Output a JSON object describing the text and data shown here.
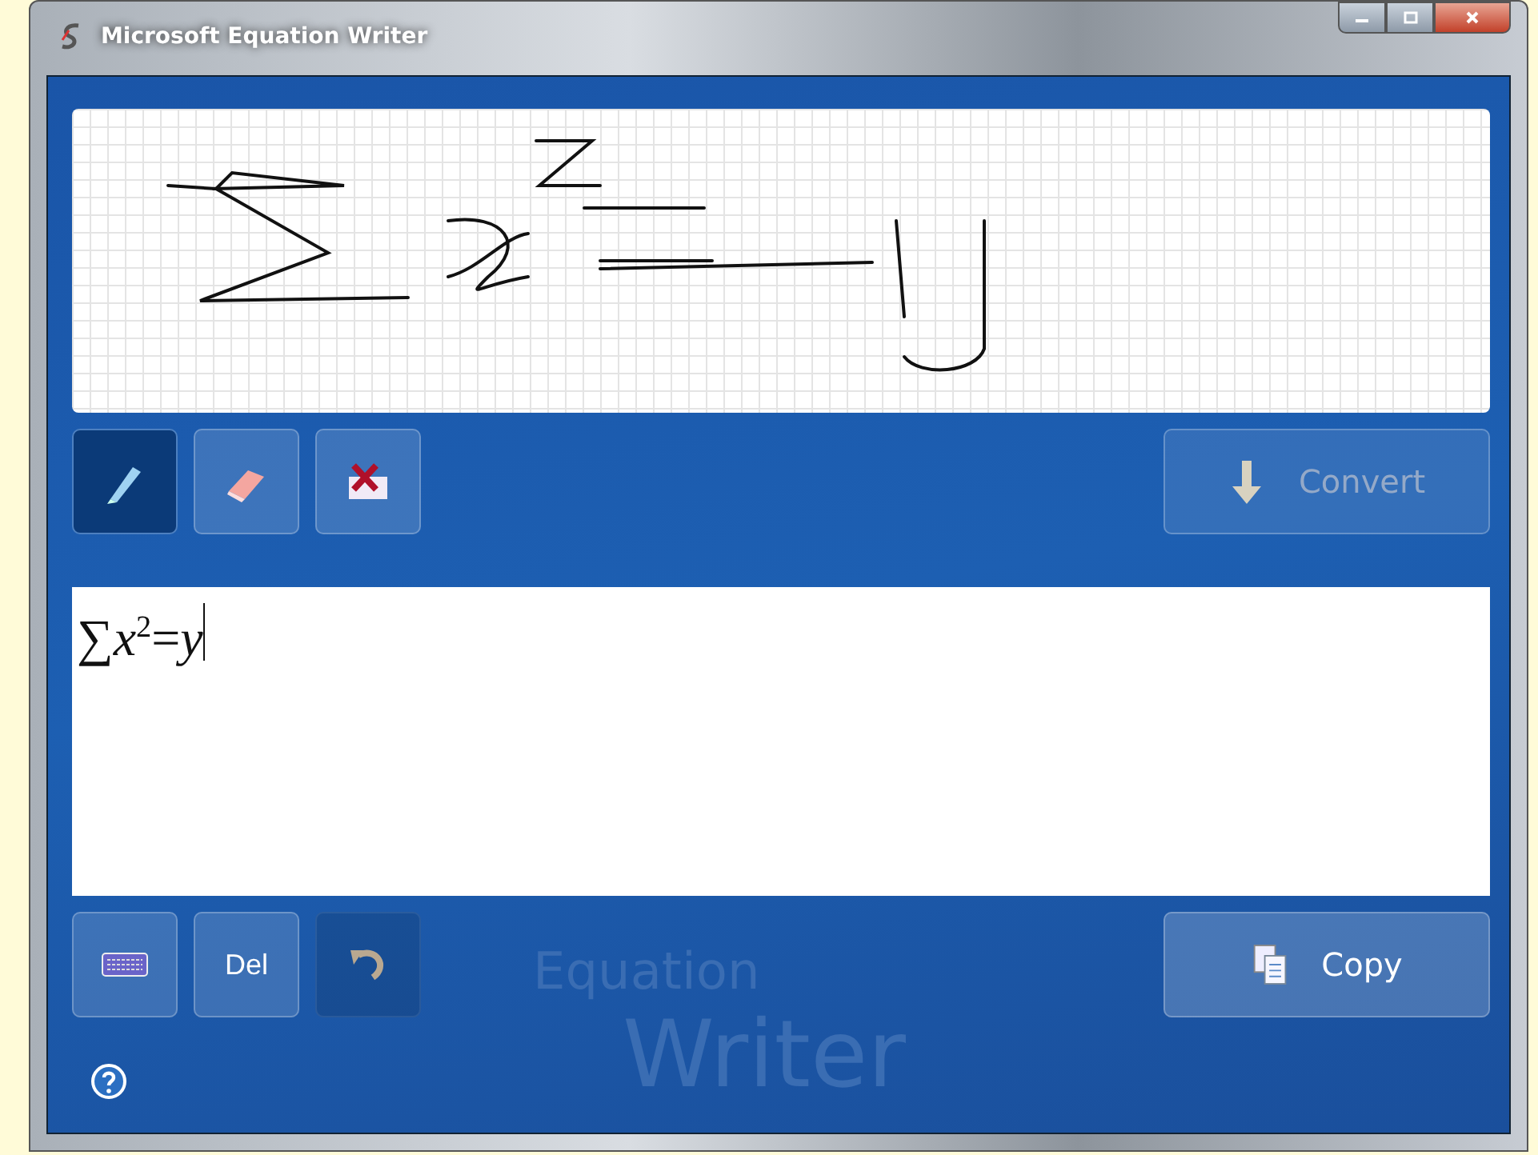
{
  "window": {
    "title": "Microsoft Equation Writer"
  },
  "tools": [
    {
      "kind": "pen",
      "selected": true
    },
    {
      "kind": "eraser",
      "selected": false
    },
    {
      "kind": "clear",
      "selected": false
    }
  ],
  "convert": {
    "label": "Convert",
    "disabled": true
  },
  "result": {
    "value": "∑*x*$^{2}$=*y*"
  },
  "edit_buttons": [
    {
      "kind": "keyboard",
      "disabled": false
    },
    {
      "kind": "delete",
      "label": "Del",
      "disabled": false
    },
    {
      "kind": "undo",
      "disabled": true
    }
  ],
  "copy": {
    "label": "Copy",
    "disabled": false
  },
  "watermark": [
    "Equation",
    "Writer"
  ]
}
